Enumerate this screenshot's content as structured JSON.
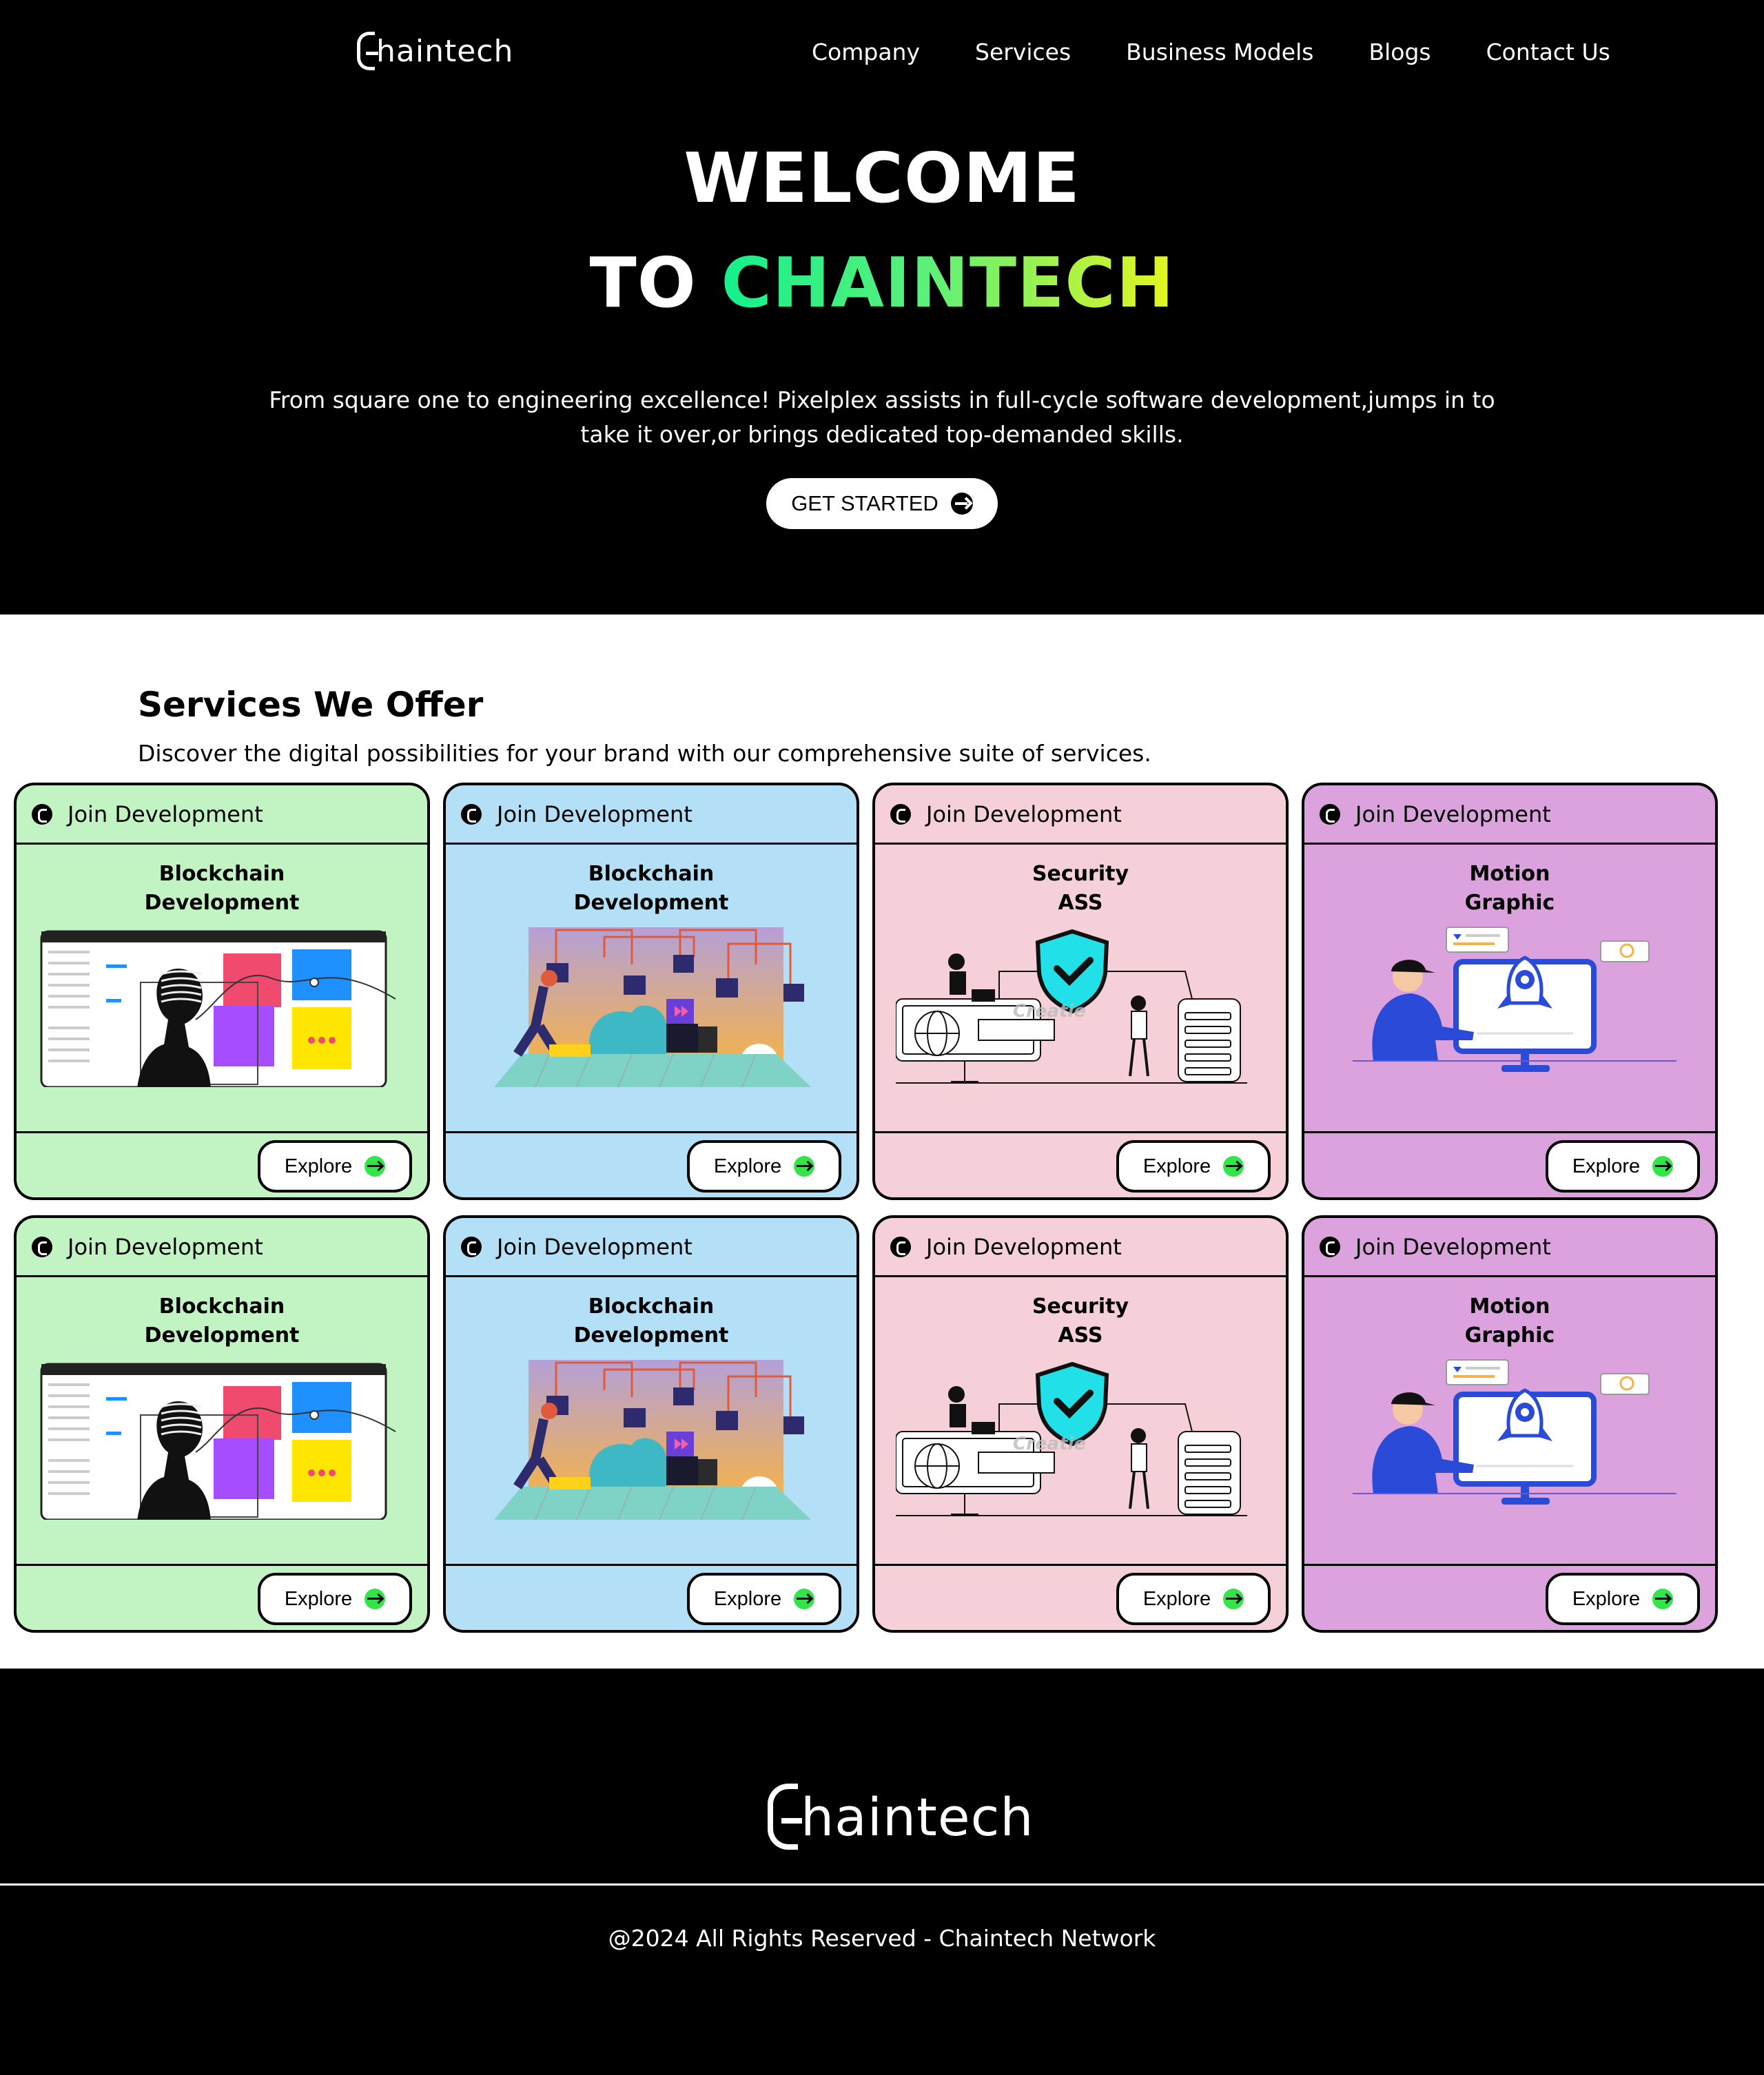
{
  "brand": {
    "logo_text": "haintech"
  },
  "nav": {
    "items": [
      {
        "label": "Company"
      },
      {
        "label": "Services"
      },
      {
        "label": "Business Models"
      },
      {
        "label": "Blogs"
      },
      {
        "label": "Contact Us"
      }
    ]
  },
  "hero": {
    "title_line1": "WELCOME",
    "title_to": "TO ",
    "title_brand": "CHAINTECH",
    "description": "From square one to engineering excellence! Pixelplex assists in full-cycle software development,jumps in to take it over,or brings dedicated top-demanded skills.",
    "cta_label": "GET STARTED"
  },
  "services": {
    "title": "Services We Offer",
    "subtitle": "Discover the digital possibilities for your brand with our comprehensive suite of services.",
    "cards": [
      {
        "header": "Join Development",
        "title": "Blockchain\nDevelopment",
        "button": "Explore",
        "theme": "#c2f4c3",
        "illustration": "design-app-illustration"
      },
      {
        "header": "Join Development",
        "title": "Blockchain\nDevelopment",
        "button": "Explore",
        "theme": "#b3dff7",
        "illustration": "blockchain-network-illustration"
      },
      {
        "header": "Join Development",
        "title": "Security\nASS",
        "button": "Explore",
        "theme": "#f6d0d8",
        "illustration": "security-shield-illustration",
        "illustration_text": "Creatie"
      },
      {
        "header": "Join Development",
        "title": "Motion\nGraphic",
        "button": "Explore",
        "theme": "#dba2de",
        "illustration": "motion-graphic-illustration"
      },
      {
        "header": "Join Development",
        "title": "Blockchain\nDevelopment",
        "button": "Explore",
        "theme": "#c2f4c3",
        "illustration": "design-app-illustration"
      },
      {
        "header": "Join Development",
        "title": "Blockchain\nDevelopment",
        "button": "Explore",
        "theme": "#b3dff7",
        "illustration": "blockchain-network-illustration"
      },
      {
        "header": "Join Development",
        "title": "Security\nASS",
        "button": "Explore",
        "theme": "#f6d0d8",
        "illustration": "security-shield-illustration",
        "illustration_text": "Creatie"
      },
      {
        "header": "Join Development",
        "title": "Motion\nGraphic",
        "button": "Explore",
        "theme": "#dba2de",
        "illustration": "motion-graphic-illustration"
      }
    ]
  },
  "footer": {
    "logo_text": "haintech",
    "copyright": "@2024 All Rights Reserved - Chaintech Network"
  },
  "colors": {
    "background": "#000000",
    "accent_gradient_start": "#14f08c",
    "accent_gradient_end": "#e6f51e",
    "explore_dot": "#35e34a"
  }
}
